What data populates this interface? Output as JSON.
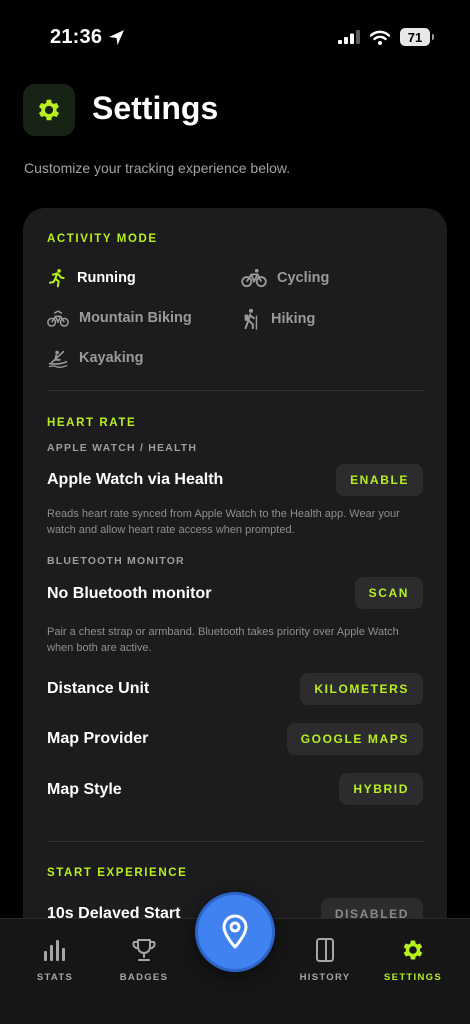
{
  "status_bar": {
    "time": "21:36",
    "battery": "71"
  },
  "header": {
    "title": "Settings",
    "subtitle": "Customize your tracking experience below."
  },
  "activity_mode": {
    "label": "ACTIVITY MODE",
    "selected": "Running",
    "items": [
      {
        "label": "Running",
        "icon": "running-icon"
      },
      {
        "label": "Cycling",
        "icon": "cycling-icon"
      },
      {
        "label": "Mountain Biking",
        "icon": "mountain-biking-icon"
      },
      {
        "label": "Hiking",
        "icon": "hiking-icon"
      },
      {
        "label": "Kayaking",
        "icon": "kayaking-icon"
      }
    ]
  },
  "heart_rate": {
    "label": "HEART RATE",
    "apple_watch": {
      "sub_label": "APPLE WATCH / HEALTH",
      "title": "Apple Watch via Health",
      "button": "ENABLE",
      "description": "Reads heart rate synced from Apple Watch to the Health app. Wear your watch and allow heart rate access when prompted."
    },
    "bluetooth": {
      "sub_label": "BLUETOOTH MONITOR",
      "title": "No Bluetooth monitor",
      "button": "SCAN",
      "description": "Pair a chest strap or armband. Bluetooth takes priority over Apple Watch when both are active."
    }
  },
  "preferences": {
    "distance_unit": {
      "label": "Distance Unit",
      "value": "KILOMETERS"
    },
    "map_provider": {
      "label": "Map Provider",
      "value": "GOOGLE MAPS"
    },
    "map_style": {
      "label": "Map Style",
      "value": "HYBRID"
    }
  },
  "start_experience": {
    "label": "START EXPERIENCE",
    "delayed_start": {
      "label": "10s Delayed Start",
      "value": "DISABLED"
    }
  },
  "tab_bar": {
    "tabs": [
      {
        "label": "STATS",
        "icon": "bar-chart-icon"
      },
      {
        "label": "BADGES",
        "icon": "trophy-icon"
      },
      {
        "label": "HISTORY",
        "icon": "history-icon"
      },
      {
        "label": "SETTINGS",
        "icon": "gear-icon"
      }
    ],
    "active": "SETTINGS",
    "center_action_icon": "location-pin-icon"
  },
  "colors": {
    "accent": "#b8ef1e",
    "background": "#000000",
    "card": "#1c1c1e",
    "fab": "#3f82f0"
  }
}
